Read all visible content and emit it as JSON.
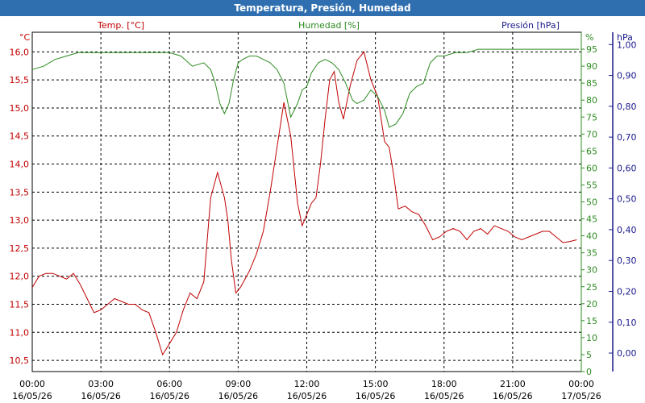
{
  "window": {
    "title": "Temperatura, Presión, Humedad"
  },
  "colors": {
    "temp": "#c00000",
    "hum": "#2e8b22",
    "pres": "#1a1a8c",
    "title_bg": "#2f6fb0",
    "grid": "#000000"
  },
  "chart_data": {
    "type": "line",
    "title": "Temperatura, Presión, Humedad",
    "x_ticks": [
      {
        "time": "00:00",
        "date": "16/05/26"
      },
      {
        "time": "03:00",
        "date": "16/05/26"
      },
      {
        "time": "06:00",
        "date": "16/05/26"
      },
      {
        "time": "09:00",
        "date": "16/05/26"
      },
      {
        "time": "12:00",
        "date": "16/05/26"
      },
      {
        "time": "15:00",
        "date": "16/05/26"
      },
      {
        "time": "18:00",
        "date": "16/05/26"
      },
      {
        "time": "21:00",
        "date": "16/05/26"
      },
      {
        "time": "00:00",
        "date": "17/05/26"
      }
    ],
    "xlim_hours": [
      0,
      24
    ],
    "axes": {
      "temp": {
        "label": "Temp. [°C]",
        "unit": "°C",
        "ylim": [
          10.3,
          16.35
        ],
        "ticks": [
          "16,0",
          "15,5",
          "15,0",
          "14,5",
          "14,0",
          "13,5",
          "13,0",
          "12,5",
          "12,0",
          "11,5",
          "11,0",
          "10,5"
        ]
      },
      "hum": {
        "label": "Humedad [%]",
        "unit": "%",
        "ylim": [
          0,
          100
        ],
        "ticks": [
          "95",
          "90",
          "85",
          "80",
          "75",
          "70",
          "65",
          "60",
          "55",
          "50",
          "45",
          "40",
          "35",
          "30",
          "25",
          "20",
          "15",
          "10",
          "5",
          "0"
        ]
      },
      "pres": {
        "label": "Presión [hPa]",
        "unit": "hPa",
        "ylim": [
          -0.06,
          1.04
        ],
        "ticks": [
          "1,00",
          "0,90",
          "0,80",
          "0,70",
          "0,60",
          "0,50",
          "0,40",
          "0,30",
          "0,20",
          "0,10",
          "0,00"
        ]
      }
    },
    "grid": true,
    "series": [
      {
        "name": "Temp. [°C]",
        "axis": "temp",
        "x": [
          0,
          0.3,
          0.6,
          0.9,
          1.2,
          1.5,
          1.8,
          2.1,
          2.4,
          2.7,
          3.0,
          3.3,
          3.6,
          3.9,
          4.2,
          4.5,
          4.8,
          5.1,
          5.4,
          5.7,
          6.0,
          6.3,
          6.6,
          6.9,
          7.2,
          7.5,
          7.8,
          8.1,
          8.4,
          8.55,
          8.7,
          8.9,
          9.1,
          9.3,
          9.5,
          9.8,
          10.1,
          10.4,
          10.7,
          11.0,
          11.3,
          11.6,
          11.8,
          12.0,
          12.2,
          12.4,
          12.6,
          12.8,
          13.0,
          13.2,
          13.4,
          13.6,
          13.9,
          14.2,
          14.5,
          14.8,
          15.1,
          15.4,
          15.6,
          15.8,
          16.0,
          16.3,
          16.6,
          16.9,
          17.2,
          17.5,
          17.8,
          18.1,
          18.4,
          18.7,
          19.0,
          19.3,
          19.6,
          19.9,
          20.2,
          20.5,
          20.8,
          21.1,
          21.4,
          21.7,
          22.0,
          22.3,
          22.6,
          22.9,
          23.2,
          23.5,
          23.8
        ],
        "y": [
          11.8,
          12.0,
          12.05,
          12.05,
          12.0,
          11.95,
          12.05,
          11.85,
          11.6,
          11.35,
          11.4,
          11.5,
          11.6,
          11.55,
          11.5,
          11.5,
          11.4,
          11.35,
          11.0,
          10.6,
          10.8,
          11.0,
          11.4,
          11.7,
          11.6,
          11.9,
          13.4,
          13.85,
          13.4,
          13.0,
          12.3,
          11.7,
          11.8,
          11.95,
          12.1,
          12.4,
          12.8,
          13.5,
          14.3,
          15.1,
          14.5,
          13.3,
          12.9,
          13.1,
          13.3,
          13.4,
          14.0,
          14.8,
          15.5,
          15.65,
          15.1,
          14.8,
          15.4,
          15.85,
          16.0,
          15.5,
          15.2,
          14.4,
          14.3,
          13.8,
          13.2,
          13.25,
          13.15,
          13.1,
          12.9,
          12.65,
          12.7,
          12.8,
          12.85,
          12.8,
          12.65,
          12.8,
          12.85,
          12.75,
          12.9,
          12.85,
          12.8,
          12.7,
          12.65,
          12.7,
          12.75,
          12.8,
          12.8,
          12.7,
          12.6,
          12.62,
          12.65
        ]
      },
      {
        "name": "Humedad [%]",
        "axis": "hum",
        "x": [
          0,
          0.5,
          1.0,
          1.5,
          2.0,
          2.5,
          3.0,
          3.5,
          4.0,
          4.5,
          5.0,
          5.5,
          6.0,
          6.5,
          7.0,
          7.5,
          7.8,
          8.0,
          8.2,
          8.4,
          8.6,
          8.8,
          9.0,
          9.2,
          9.5,
          9.8,
          10.1,
          10.4,
          10.7,
          11.0,
          11.3,
          11.6,
          11.8,
          12.0,
          12.2,
          12.5,
          12.8,
          13.1,
          13.4,
          13.7,
          14.0,
          14.2,
          14.5,
          14.8,
          15.1,
          15.4,
          15.6,
          15.9,
          16.2,
          16.5,
          16.8,
          17.1,
          17.4,
          17.7,
          18.0,
          18.5,
          19.0,
          19.5,
          20.0,
          20.5,
          21.0,
          21.5,
          22.0,
          22.5,
          23.0,
          23.5,
          23.9
        ],
        "y": [
          89,
          90,
          92,
          93,
          94,
          94,
          94,
          94,
          94,
          94,
          94,
          94,
          94,
          93,
          90,
          91,
          89,
          85,
          79,
          76,
          79,
          86,
          91,
          92,
          93,
          93,
          92,
          91,
          89,
          85,
          75,
          79,
          83,
          84,
          88,
          91,
          92,
          91,
          89,
          85,
          80,
          79,
          80,
          83,
          81,
          77,
          72,
          73,
          76,
          82,
          84,
          85,
          91,
          93,
          93,
          94,
          94,
          95,
          95,
          95,
          95,
          95,
          95,
          95,
          95,
          95,
          95
        ]
      }
    ]
  }
}
